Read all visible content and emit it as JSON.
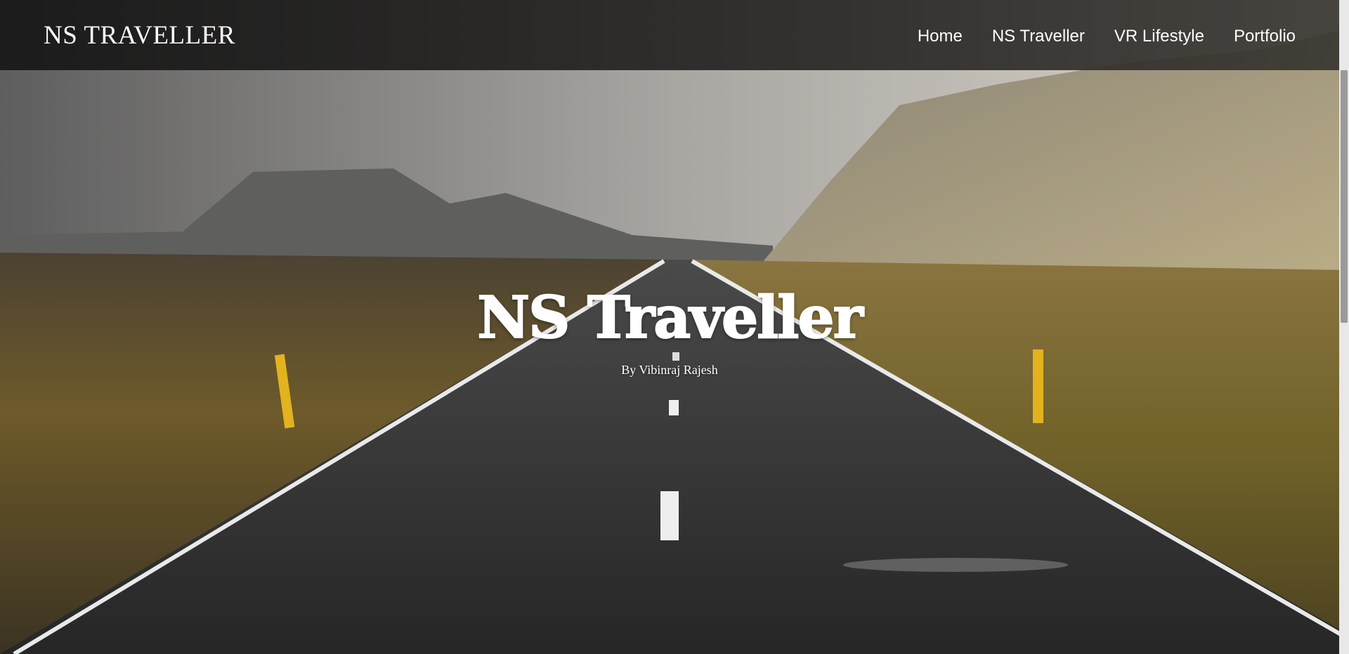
{
  "navbar": {
    "brand": "NS TRAVELLER",
    "links": [
      {
        "label": "Home"
      },
      {
        "label": "NS Traveller"
      },
      {
        "label": "VR Lifestyle"
      },
      {
        "label": "Portfolio"
      }
    ]
  },
  "hero": {
    "title": "NS Traveller",
    "subtitle": "By Vibinraj Rajesh"
  },
  "colors": {
    "sky": "#bdb8b2",
    "grass": "#7a6a32",
    "road": "#2b2b2b",
    "marker": "#e3b21f"
  }
}
